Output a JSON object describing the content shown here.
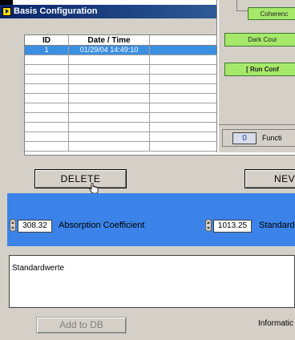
{
  "window": {
    "title": "Basis Configuration"
  },
  "table": {
    "headers": [
      "ID",
      "Date / Time",
      ""
    ],
    "rows": [
      {
        "id": "1",
        "datetime": "01/29/04 14:49:10",
        "extra": ""
      }
    ]
  },
  "buttons": {
    "delete": "DELETE",
    "new": "NEV",
    "add_to_db": "Add to DB"
  },
  "params": {
    "absorption_value": "308.32",
    "absorption_label": "Absorption Coefficient",
    "standard_value": "1013.25",
    "standard_label": "Standard"
  },
  "notes": {
    "text": "Standardwerte",
    "information_label": "Informatic"
  },
  "right_panel": {
    "coherence": "Coherenc",
    "dark_count": "Dark Cour",
    "run_conf": "[ Run Conf",
    "function_value": "0",
    "function_label": "Functi"
  },
  "colors": {
    "selection": "#3c8ee0",
    "band": "#3b83e8",
    "green_button": "#a6e86a",
    "titlebar": "#0a246a"
  }
}
